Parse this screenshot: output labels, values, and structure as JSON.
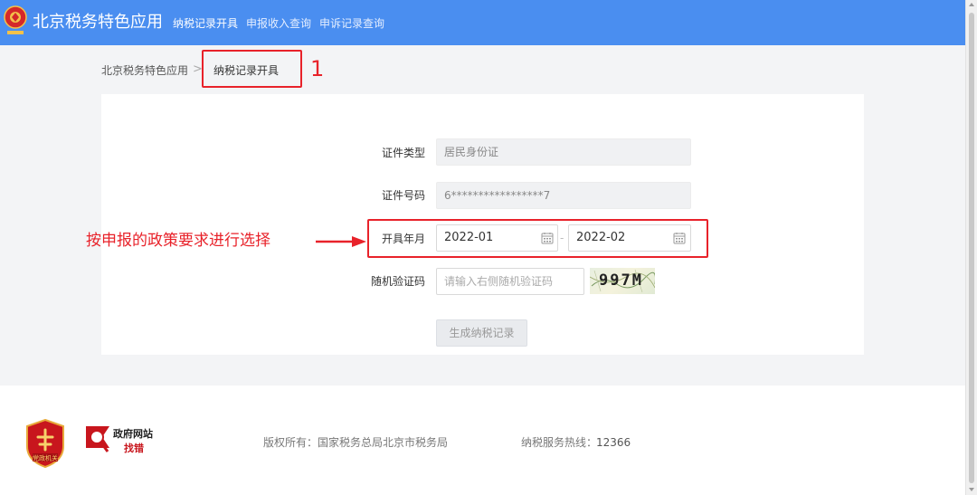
{
  "header": {
    "site_title": "北京税务特色应用",
    "nav": [
      {
        "label": "纳税记录开具",
        "active": true
      },
      {
        "label": "申报收入查询",
        "active": false
      },
      {
        "label": "申诉记录查询",
        "active": false
      }
    ]
  },
  "breadcrumb": {
    "home": "北京税务特色应用",
    "separator": ">",
    "current": "纳税记录开具"
  },
  "form": {
    "id_type": {
      "label": "证件类型",
      "value": "居民身份证"
    },
    "id_number": {
      "label": "证件号码",
      "value": "6*****************7"
    },
    "issue_period": {
      "label": "开具年月",
      "start": "2022-01",
      "end": "2022-02",
      "dash": "-"
    },
    "captcha": {
      "label": "随机验证码",
      "placeholder": "请输入右侧随机验证码",
      "image_text": "997M"
    },
    "submit_label": "生成纳税记录"
  },
  "annotations": {
    "step_number": "1",
    "instruction": "按申报的政策要求进行选择",
    "color": "#e8222a"
  },
  "footer": {
    "party_badge": "党政机关",
    "gov_site_title": "政府网站",
    "gov_site_sub": "找错",
    "copyright": "版权所有：国家税务总局北京市税务局",
    "hotline_label": "纳税服务热线：",
    "hotline_number": "12366"
  },
  "colors": {
    "header_bg": "#4a8ef0",
    "annotation": "#e8222a",
    "page_bg": "#f3f4f6"
  }
}
